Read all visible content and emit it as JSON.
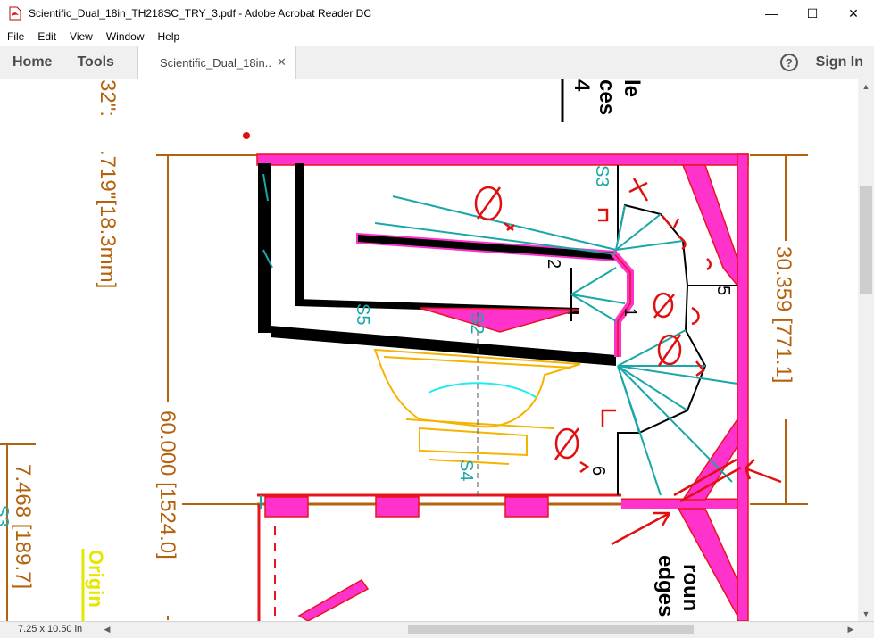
{
  "window": {
    "title": "Scientific_Dual_18in_TH218SC_TRY_3.pdf - Adobe Acrobat Reader DC",
    "icon": "pdf-file-icon",
    "controls": {
      "minimize": "—",
      "maximize": "☐",
      "close": "✕"
    }
  },
  "menu": [
    "File",
    "Edit",
    "View",
    "Window",
    "Help"
  ],
  "tabs": {
    "home": "Home",
    "tools": "Tools",
    "document": "Scientific_Dual_18in...",
    "close": "✕",
    "help": "?",
    "signin": "Sign In"
  },
  "status": {
    "page_size": "7.25 x 10.50 in"
  },
  "drawing": {
    "dim_top_left": ".719\"[18.3mm]",
    "dim_top_left_partial": "32\":",
    "dim_right": "30.359  [771.1]",
    "dim_center": "60.000  [1524.0]",
    "dim_bottom_left": "7.468  [189.7]",
    "label_s3": "S3",
    "label_s3_bottom": "S3",
    "label_s2": "S2",
    "label_s4": "S4",
    "label_s5": "S5",
    "label_2": "2",
    "label_5": "5",
    "label_6": "6",
    "label_1": "1",
    "note_top": "le",
    "note_top2": "ces",
    "note_top3": "4",
    "note_round": "roun",
    "note_edges": "edges",
    "note_origin": "Origin"
  },
  "colors": {
    "dimension": "#b5620f",
    "magenta": "#ff33cc",
    "teal": "#1aa7a7",
    "orange": "#f5b400",
    "red": "#e8141e",
    "annotation": "#e01010",
    "yellow": "#e6e600"
  }
}
